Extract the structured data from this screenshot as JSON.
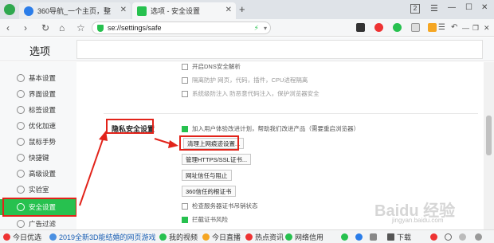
{
  "tabs": [
    {
      "title": "360导航_一个主页，整",
      "close": "✕"
    },
    {
      "title": "选项 - 安全设置",
      "close": "✕"
    }
  ],
  "new_tab": "+",
  "window_controls": {
    "badge": "2",
    "menu": "☰",
    "minimize": "—",
    "maximize": "☐",
    "close": "✕"
  },
  "address": {
    "url": "se://settings/safe"
  },
  "nav": {
    "back": "‹",
    "forward": "›",
    "refresh": "↻",
    "home": "⌂",
    "menu": "☰",
    "undo": "↶",
    "minimize": "—",
    "restore": "❐",
    "close": "✕"
  },
  "page_title": "选项",
  "sidebar": {
    "items": [
      {
        "label": "基本设置",
        "active": false
      },
      {
        "label": "界面设置",
        "active": false
      },
      {
        "label": "标签设置",
        "active": false
      },
      {
        "label": "优化加速",
        "active": false
      },
      {
        "label": "鼠标手势",
        "active": false
      },
      {
        "label": "快捷键",
        "active": false
      },
      {
        "label": "高级设置",
        "active": false
      },
      {
        "label": "实验室",
        "active": false
      },
      {
        "label": "安全设置",
        "active": true
      },
      {
        "label": "广告过滤",
        "active": false
      }
    ]
  },
  "content": {
    "top_options": [
      {
        "label": "开启DNS安全解析",
        "checked": false
      },
      {
        "label": "隔离防护  网页，代码，插件，CPU进程隔离",
        "checked": false
      },
      {
        "label": "系统级防注入  防恶意代码注入，保护浏览器安全",
        "checked": false
      }
    ],
    "section_title": "隐私安全设置",
    "improve_option": {
      "label": "加入用户体验改进计划，帮助我们改进产品（需要重启浏览器）",
      "checked": true
    },
    "buttons": {
      "clear_data": "清理上网痕迹设置...",
      "https_cert": "管理HTTPS/SSL证书...",
      "site_trust": "网址信任与阻止",
      "cert_360": "360信任的根证书"
    },
    "bottom_options": [
      {
        "label": "检查服务器证书吊销状态",
        "checked": false
      },
      {
        "label": "拦截证书风险",
        "checked": true
      }
    ]
  },
  "watermark": "Baidu 经验",
  "watermark_sub": "jingyan.baidu.com",
  "bottom_bar": {
    "items": [
      {
        "label": "今日优选"
      },
      {
        "label": "2019全新3D能结婚的网页游戏《"
      },
      {
        "label": "我的视频"
      },
      {
        "label": "今日直播"
      },
      {
        "label": "热点资讯"
      },
      {
        "label": "网络信用"
      },
      {
        "label": "下载"
      }
    ]
  },
  "colors": {
    "accent": "#27c14f",
    "annotation": "#e2231a"
  }
}
